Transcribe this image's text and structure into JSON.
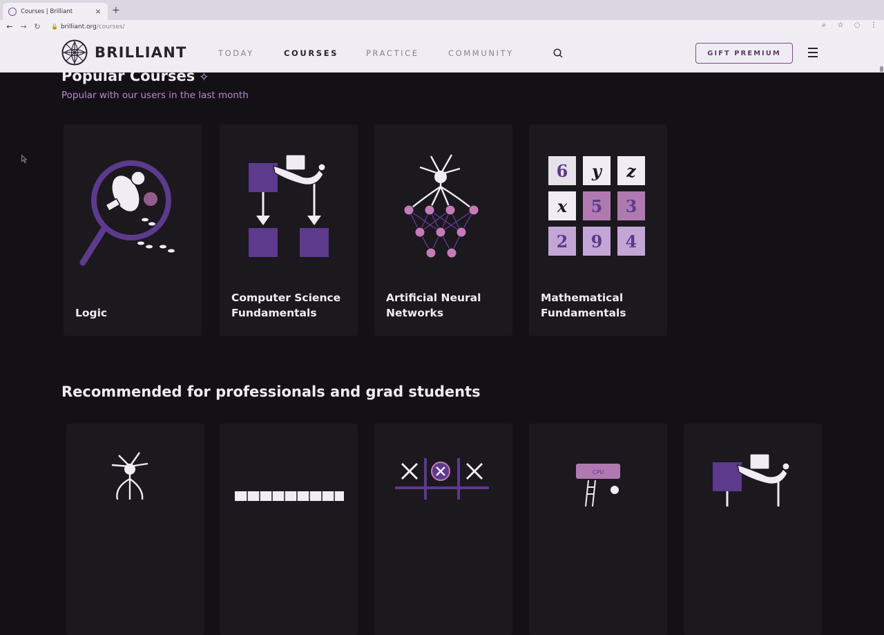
{
  "browser": {
    "tab_title": "Courses | Brilliant",
    "tab_close": "×",
    "new_tab": "+",
    "url_host": "brilliant.org",
    "url_path": "/courses/"
  },
  "header": {
    "logo_text": "BRILLIANT",
    "nav": [
      {
        "label": "TODAY"
      },
      {
        "label": "COURSES"
      },
      {
        "label": "PRACTICE"
      },
      {
        "label": "COMMUNITY"
      }
    ],
    "gift_label": "GIFT PREMIUM"
  },
  "popular": {
    "title": "Popular Courses",
    "sparkle": "✧",
    "subtitle": "Popular with our users in the last month",
    "courses": [
      {
        "title": "Logic"
      },
      {
        "title": "Computer Science\nFundamentals"
      },
      {
        "title": "Artificial Neural\nNetworks"
      },
      {
        "title": "Mathematical\nFundamentals"
      }
    ],
    "math_tiles": [
      "6",
      "y",
      "z",
      "x",
      "5",
      "3",
      "2",
      "9",
      "4"
    ]
  },
  "recommended": {
    "title": "Recommended for professionals and grad students",
    "cpu_label": "CPU"
  },
  "colors": {
    "background": "#141116",
    "card": "#1b181e",
    "accent_purple": "#5c3a8c",
    "node_pink": "#c47bb8",
    "subtitle_purple": "#b98ad0"
  }
}
